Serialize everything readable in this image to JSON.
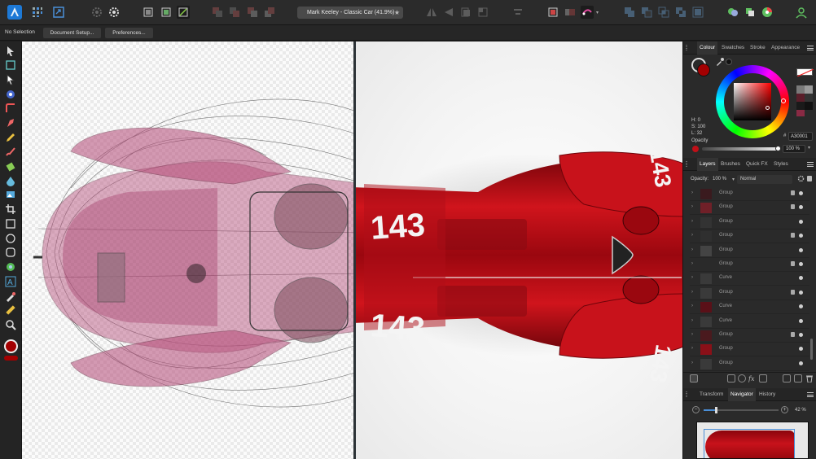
{
  "app": {
    "document_title": "Mark Keeley - Classic Car (41.9%)"
  },
  "context_bar": {
    "selection": "No Selection",
    "document_setup": "Document Setup...",
    "preferences": "Preferences..."
  },
  "colour_panel": {
    "tabs": [
      "Colour",
      "Swatches",
      "Stroke",
      "Appearance"
    ],
    "h": "H: 0",
    "s": "S: 100",
    "l": "L: 32",
    "opacity_label": "Opacity",
    "hex_prefix": "#",
    "hex_value": "A30001",
    "opacity_value": "100 %",
    "opacity_fraction": 1.0,
    "current_color": "#a30001"
  },
  "layers_panel": {
    "tabs": [
      "Layers",
      "Brushes",
      "Quick FX",
      "Styles"
    ],
    "opacity_label": "Opacity:",
    "opacity_value": "100 %",
    "blend_mode": "Normal",
    "rows": [
      {
        "name": "Group",
        "locked": true
      },
      {
        "name": "Group",
        "locked": true
      },
      {
        "name": "Group",
        "locked": false
      },
      {
        "name": "Group",
        "locked": true
      },
      {
        "name": "Group",
        "locked": false
      },
      {
        "name": "Group",
        "locked": true
      },
      {
        "name": "Curve",
        "locked": false
      },
      {
        "name": "Group",
        "locked": true
      },
      {
        "name": "Curve",
        "locked": false
      },
      {
        "name": "Curve",
        "locked": false
      },
      {
        "name": "Group",
        "locked": true
      },
      {
        "name": "Group",
        "locked": false
      },
      {
        "name": "Group",
        "locked": false
      }
    ]
  },
  "navigator_panel": {
    "tabs": [
      "Transform",
      "Navigator",
      "History"
    ],
    "zoom": "42 %",
    "zoom_fraction": 0.42
  },
  "canvas": {
    "car_numbers": [
      "143",
      "143",
      "143",
      "143"
    ]
  },
  "colors": {
    "accent": "#2b7fd8",
    "car_red": "#b0101a",
    "toolbar_bg": "#2b2b2b"
  }
}
